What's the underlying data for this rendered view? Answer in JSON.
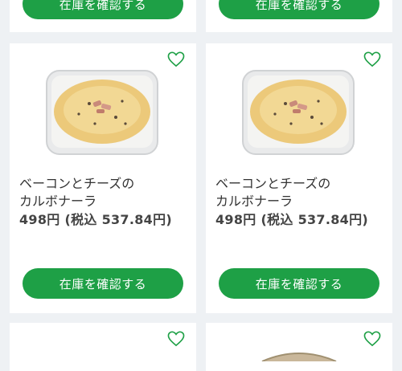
{
  "button_label": "在庫を確認する",
  "products": [
    {
      "name_line1": "ベーコンとチーズの",
      "name_line2": "カルボナーラ",
      "price": "498円",
      "price_tax": "(税込 537.84円)"
    },
    {
      "name_line1": "ベーコンとチーズの",
      "name_line2": "カルボナーラ",
      "price": "498円",
      "price_tax": "(税込 537.84円)"
    }
  ],
  "colors": {
    "accent": "#1ea046",
    "background": "#eef1f4"
  },
  "icons": {
    "favorite": "heart-outline-icon"
  }
}
